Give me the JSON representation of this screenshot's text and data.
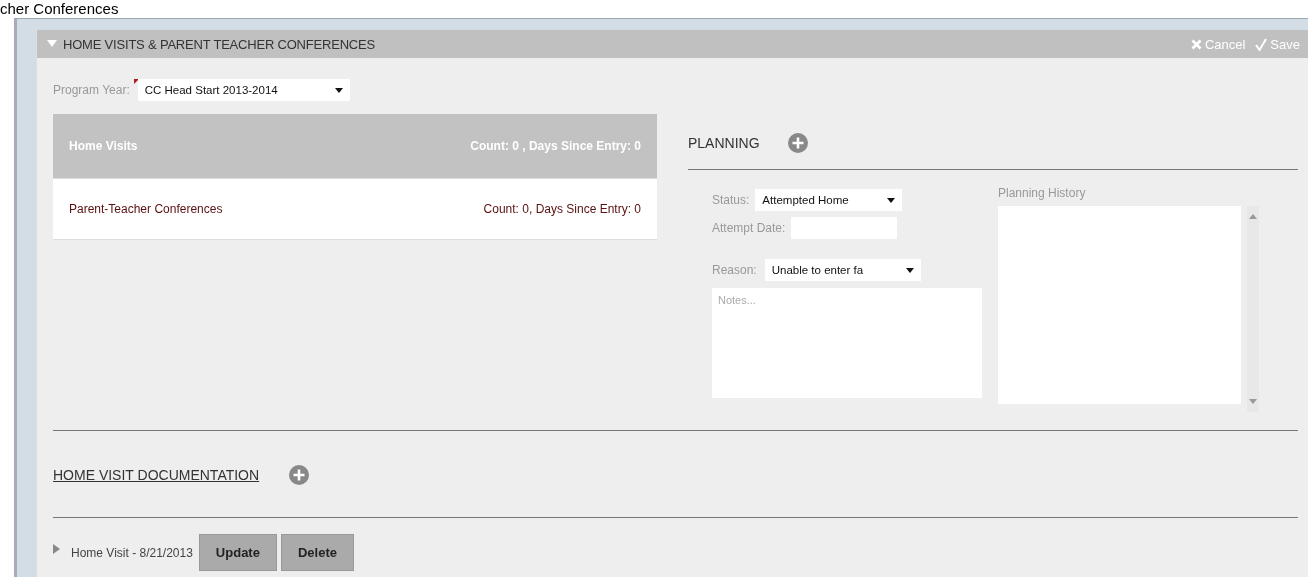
{
  "page_title": "cher Conferences",
  "panel": {
    "title": "HOME VISITS & PARENT TEACHER CONFERENCES",
    "expanded": true,
    "actions": [
      {
        "label": "Cancel",
        "kind": "cancel"
      },
      {
        "label": "Save",
        "kind": "save"
      }
    ]
  },
  "program_year": {
    "label": "Program Year:",
    "value": "CC Head Start 2013-2014",
    "required": true
  },
  "categories": [
    {
      "name": "Home Visits",
      "summary": "Count: 0 , Days Since Entry: 0",
      "selected": true
    },
    {
      "name": "Parent-Teacher Conferences",
      "summary": "Count: 0, Days Since Entry: 0",
      "selected": false
    }
  ],
  "planning": {
    "title": "PLANNING",
    "status": {
      "label": "Status:",
      "value": "Attempted Home"
    },
    "attempt_date": {
      "label": "Attempt Date:"
    },
    "reason": {
      "label": "Reason:",
      "value": "Unable to enter fa"
    },
    "notes": {
      "placeholder": "Notes..."
    },
    "history": {
      "label": "Planning History"
    }
  },
  "documentation": {
    "title": "HOME VISIT DOCUMENTATION",
    "entries": [
      {
        "label": "Home Visit - 8/21/2013",
        "expanded": false,
        "buttons": [
          "Update",
          "Delete"
        ]
      }
    ]
  }
}
